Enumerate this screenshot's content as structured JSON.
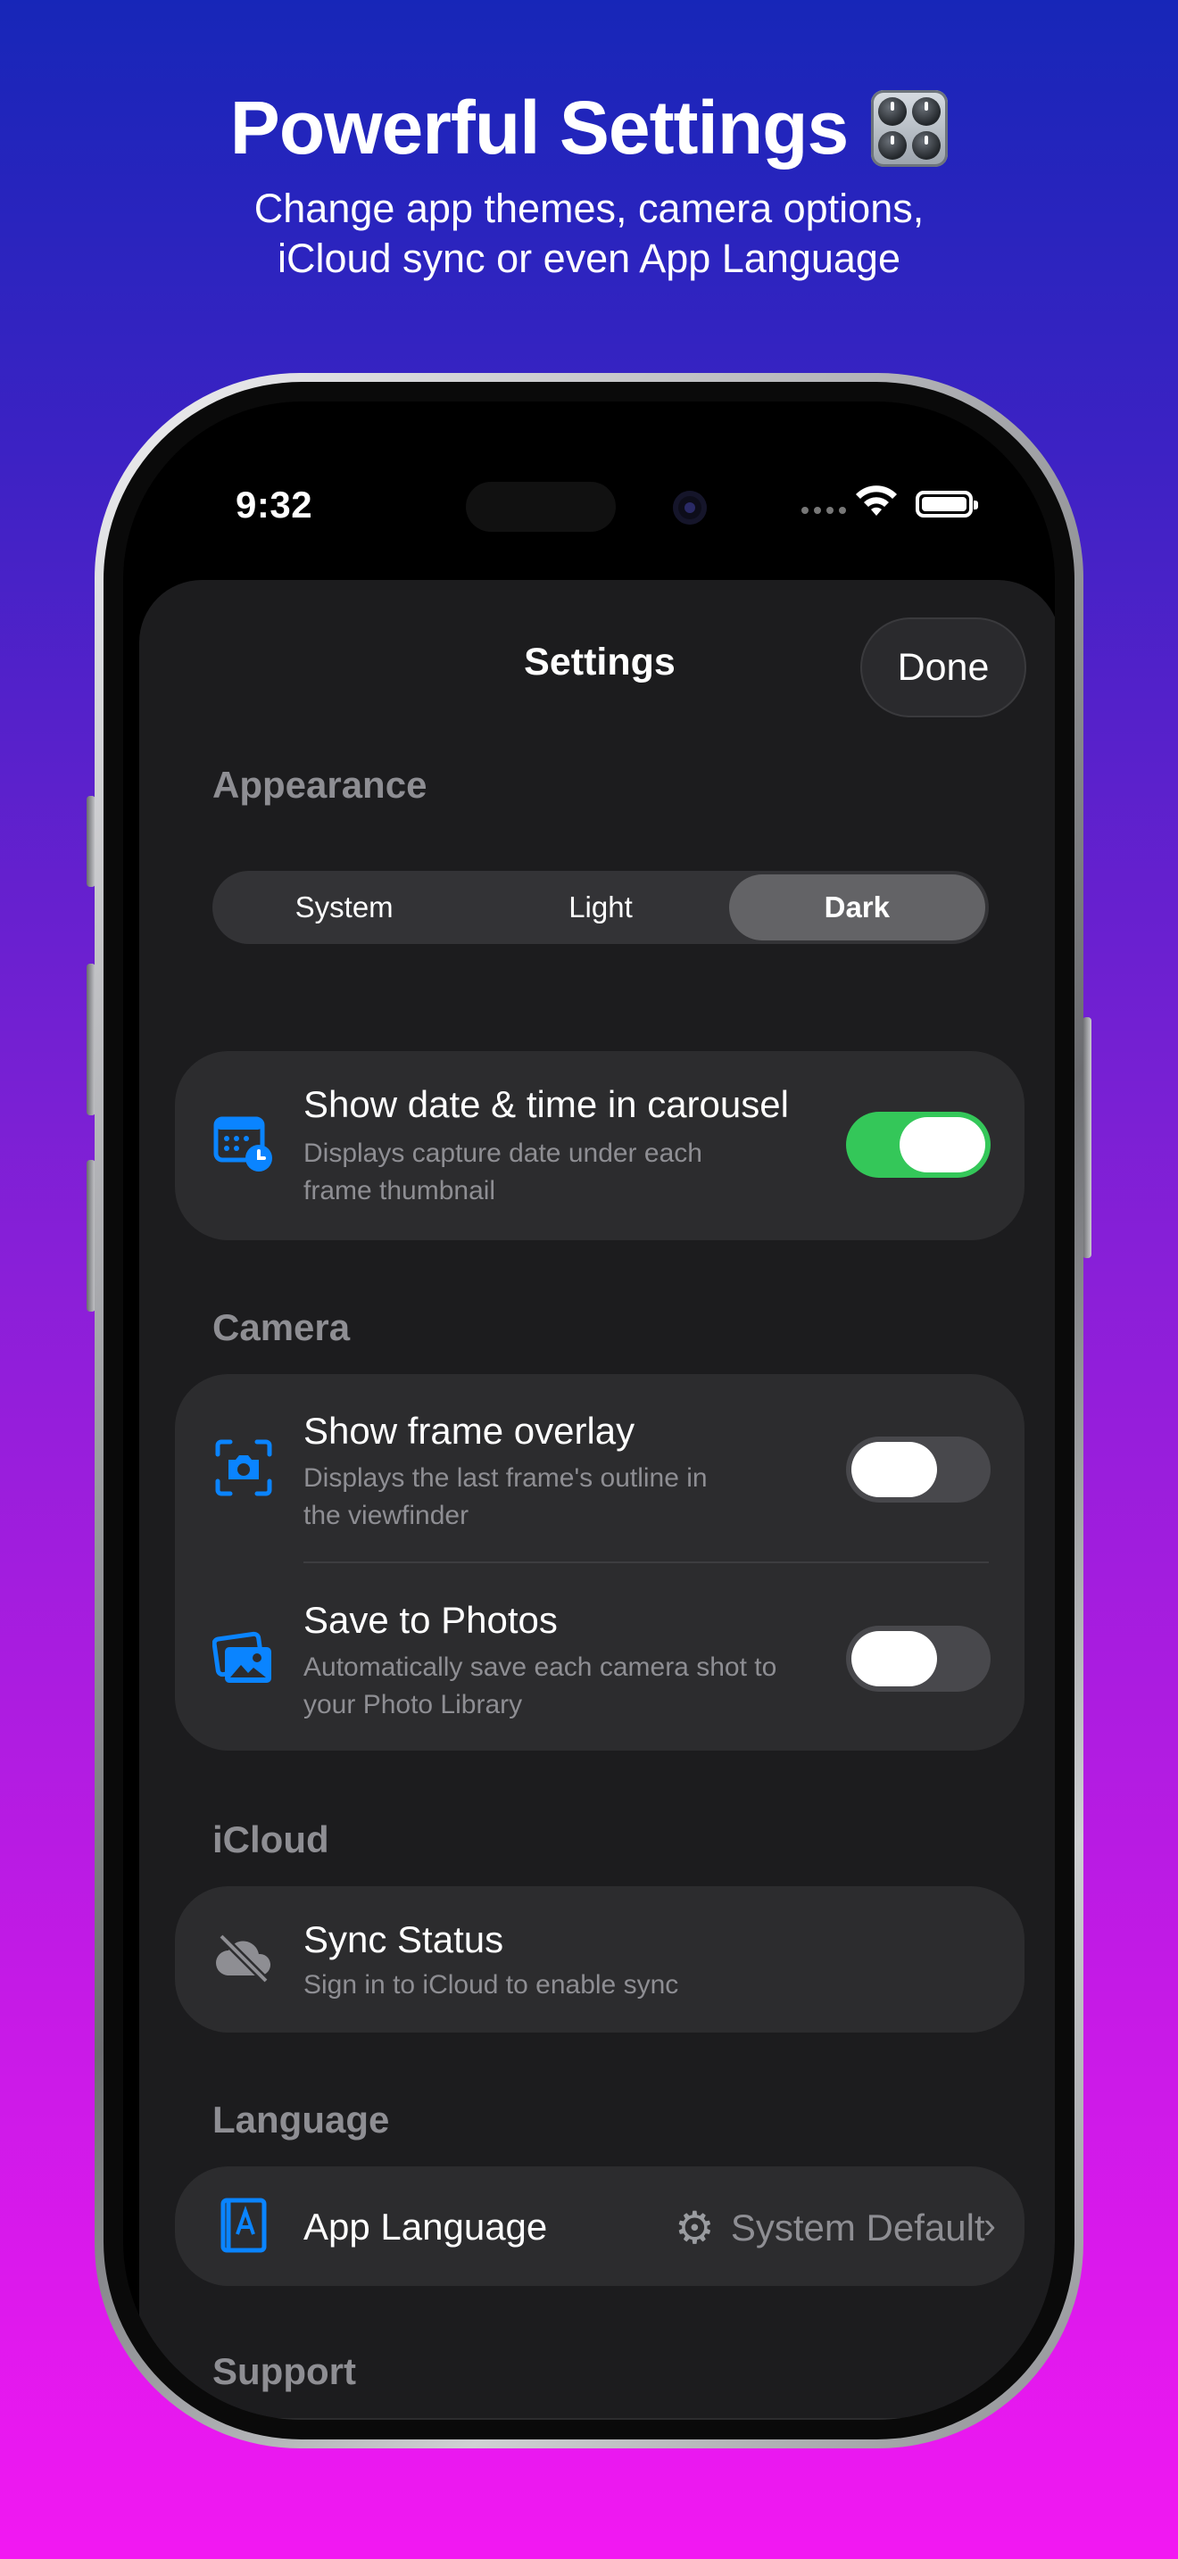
{
  "promo": {
    "title": "Powerful Settings",
    "subtitle_line1": "Change app themes, camera options,",
    "subtitle_line2": "iCloud sync or even App Language"
  },
  "status_bar": {
    "time": "9:32"
  },
  "sheet": {
    "title": "Settings",
    "done_label": "Done"
  },
  "appearance": {
    "label": "Appearance",
    "options": [
      "System",
      "Light",
      "Dark"
    ],
    "selected": "Dark"
  },
  "carousel_card": {
    "title": "Show date & time in carousel",
    "desc_line1": "Displays capture date under each",
    "desc_line2": "frame thumbnail",
    "enabled": true
  },
  "camera": {
    "label": "Camera",
    "overlay": {
      "title": "Show frame overlay",
      "desc_line1": "Displays the last frame's outline in",
      "desc_line2": "the viewfinder",
      "enabled": false
    },
    "save": {
      "title": "Save to Photos",
      "desc_line1": "Automatically save each camera shot to",
      "desc_line2": "your Photo Library",
      "enabled": false
    }
  },
  "icloud": {
    "label": "iCloud",
    "sync_title": "Sync Status",
    "sync_desc": "Sign in to iCloud to enable sync"
  },
  "language": {
    "label": "Language",
    "row_title": "App Language",
    "value": "System Default"
  },
  "support": {
    "label": "Support"
  },
  "colors": {
    "accent": "#0a84ff",
    "toggle_on": "#34c759",
    "background_top": "#1726b8",
    "background_bottom": "#f218f2"
  }
}
